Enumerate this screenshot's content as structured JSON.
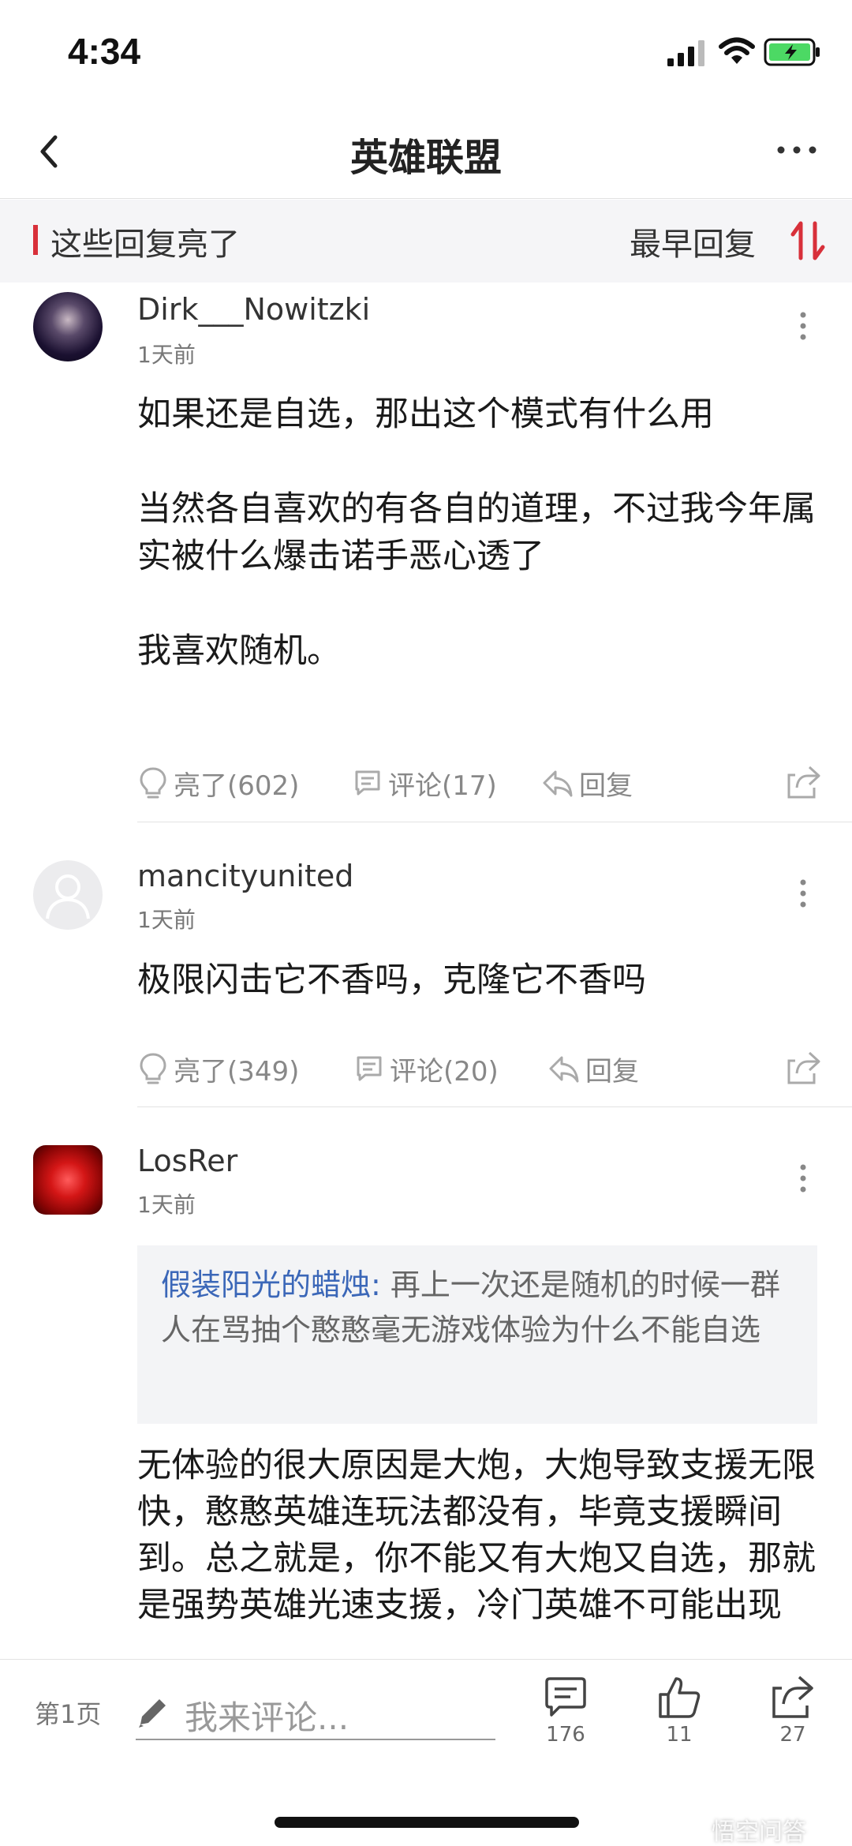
{
  "status_bar": {
    "time": "4:34"
  },
  "nav": {
    "title": "英雄联盟"
  },
  "section": {
    "title": "这些回复亮了",
    "sort_label": "最早回复"
  },
  "comments": [
    {
      "username": "Dirk___Nowitzki",
      "time": "1天前",
      "paragraphs": [
        "如果还是自选，那出这个模式有什么用",
        "当然各自喜欢的有各自的道理，不过我今年属实被什么爆击诺手恶心透了",
        "我喜欢随机。"
      ],
      "like_label": "亮了(602)",
      "comment_label": "评论(17)",
      "reply_label": "回复"
    },
    {
      "username": "mancityunited",
      "time": "1天前",
      "paragraphs": [
        "极限闪击它不香吗，克隆它不香吗"
      ],
      "like_label": "亮了(349)",
      "comment_label": "评论(20)",
      "reply_label": "回复"
    },
    {
      "username": "LosRer",
      "time": "1天前",
      "quote_user": "假装阳光的蜡烛:",
      "quote_text": " 再上一次还是随机的时候一群人在骂抽个憨憨毫无游戏体验为什么不能自选",
      "paragraphs": [
        "无体验的很大原因是大炮，大炮导致支援无限快，憨憨英雄连玩法都没有，毕竟支援瞬间到。总之就是，你不能又有大炮又自选，那就是强势英雄光速支援，冷门英雄不可能出现"
      ]
    }
  ],
  "bottom_bar": {
    "page_label": "第1页",
    "input_placeholder": "我来评论...",
    "comment_count": "176",
    "like_count": "11",
    "share_count": "27"
  },
  "watermark": "悟空问答",
  "colors": {
    "accent_red": "#d8303a",
    "quote_blue": "#3b67b8"
  }
}
